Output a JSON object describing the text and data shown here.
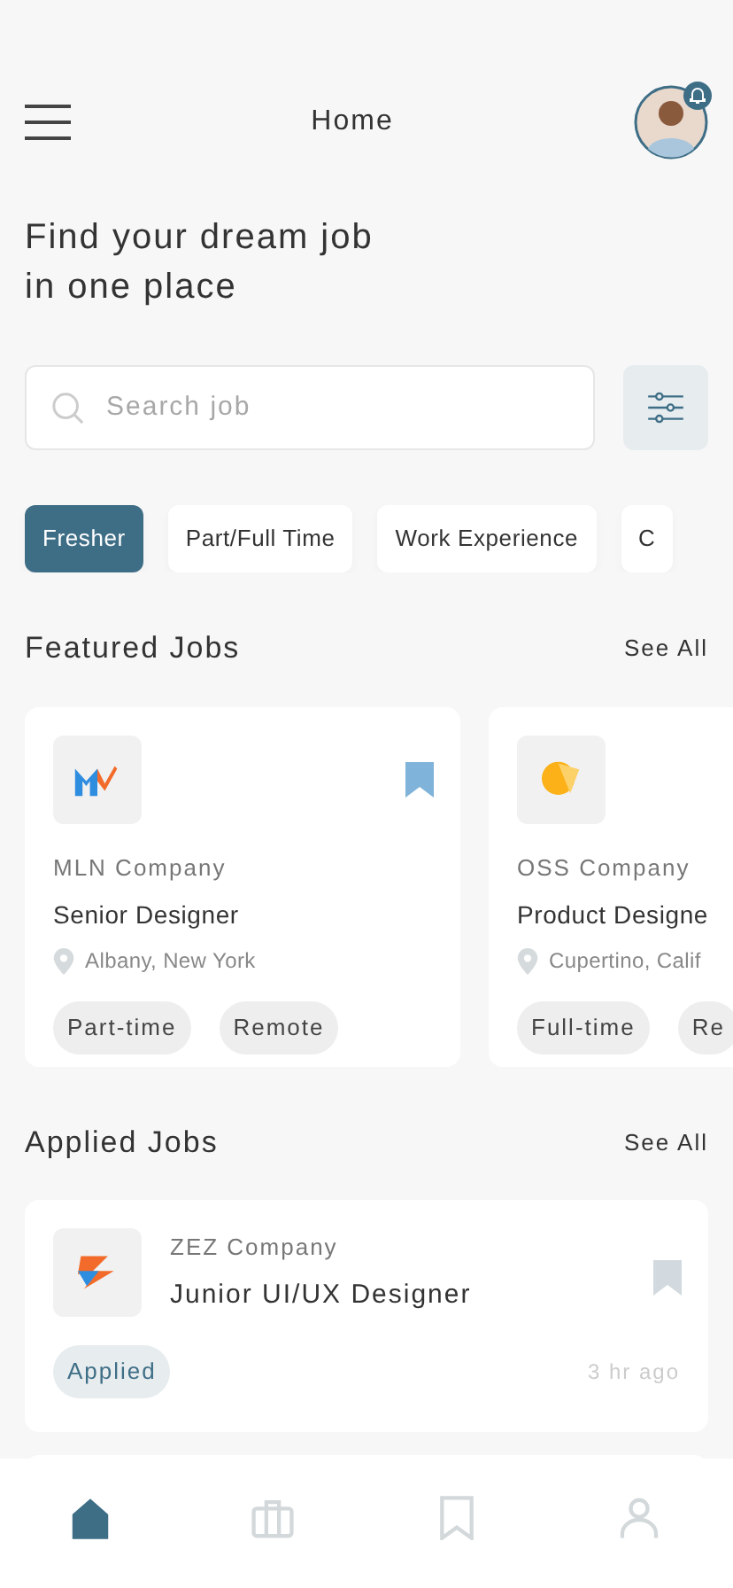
{
  "header": {
    "title": "Home",
    "notification": true
  },
  "headline": "Find your dream job\nin one place",
  "search": {
    "placeholder": "Search job"
  },
  "filters": [
    {
      "label": "Fresher",
      "selected": true
    },
    {
      "label": "Part/Full Time",
      "selected": false
    },
    {
      "label": "Work Experience",
      "selected": false
    },
    {
      "label": "C",
      "selected": false
    }
  ],
  "featured": {
    "title": "Featured Jobs",
    "link": "See All",
    "jobs": [
      {
        "company": "MLN Company",
        "role": "Senior Designer",
        "location": "Albany, New York",
        "saved": true,
        "tags": [
          "Part-time",
          "Remote"
        ]
      },
      {
        "company": "OSS Company",
        "role": "Product Designe",
        "location": "Cupertino, Calif",
        "tags": [
          "Full-time",
          "Re"
        ]
      }
    ]
  },
  "applied": {
    "title": "Applied Jobs",
    "link": "See All",
    "jobs": [
      {
        "company": "ZEZ Company",
        "role": "Junior UI/UX Designer",
        "status": "Applied",
        "time": "3 hr ago",
        "saved": false
      }
    ]
  },
  "nav": [
    {
      "selected": true
    },
    {
      "selected": false
    },
    {
      "selected": false
    },
    {
      "selected": false
    }
  ]
}
